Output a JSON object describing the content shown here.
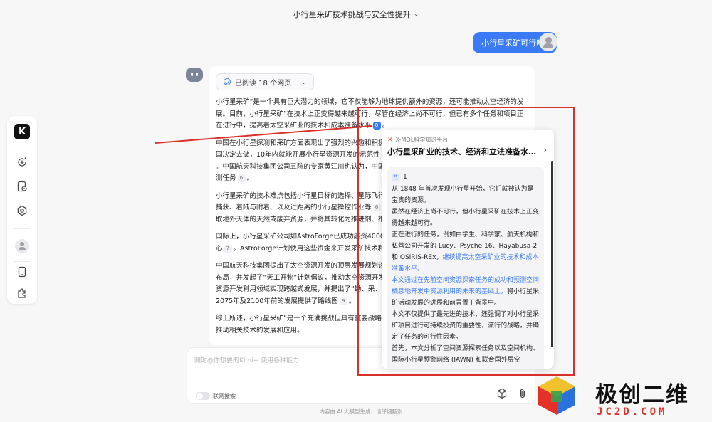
{
  "header": {
    "title": "小行星采矿技术挑战与安全性提升",
    "chevron_icon": "chevron-down-icon"
  },
  "user_message": {
    "text": "小行星采矿可行吗?"
  },
  "answer": {
    "read_chip": "已阅读 18 个网页",
    "paragraphs": [
      {
        "text_before": "小行星采矿”是一个具有巨大潜力的领域，它不仅能够为地球提供额外的资源，还可能推动太空经济的发展。目前，小行星采矿”在技术上正变得越来越可行，尽管在经济上尚不可行，但已有多个任务和项目正在进行中，提高着太空采矿业的技术和成本准备水平",
        "cite": "8",
        "text_after": "。"
      },
      {
        "text_before": "中国在小行星探测和采矿方面表现出了强烈的兴趣和积极",
        "cite": "",
        "text_after": ""
      },
      {
        "text_before": "国决定去做，10年内就能开展小行星资源开发的示范性",
        "cite": "",
        "text_after": ""
      },
      {
        "text_before": "。中国航天科技集团公司五院的专家黄江川也认为，中国",
        "cite": "",
        "text_after": ""
      },
      {
        "text_before": "测任务",
        "cite": "6",
        "text_after": "。"
      },
      {
        "text_before": "小行星采矿的技术难点包括小行星目标的选择、星际飞行",
        "cite": "",
        "text_after": ""
      },
      {
        "text_before": "捕获、着陆与附着、以及近距离的小行星操控作业等",
        "cite": "6",
        "text_after": ""
      },
      {
        "text_before": "取地外天体的天然或废弃资源，并将其转化为推进剂、推",
        "cite": "",
        "text_after": ""
      },
      {
        "text_before": "国际上，小行星采矿公司如AstroForge已成功融资4000",
        "cite": "",
        "text_after": ""
      },
      {
        "text_before": "心",
        "cite": "7",
        "text_after": "。AstroForge计划使用这些资金来开发采矿技术和"
      },
      {
        "text_before": "中国航天科技集团提出了太空资源开发的顶层发展规划设",
        "cite": "",
        "text_after": ""
      },
      {
        "text_before": "布局，并发起了“天工开物”计划倡议，推动太空资源开发",
        "cite": "",
        "text_after": ""
      },
      {
        "text_before": "资源开发利用领域实现跨越式发展，并提出了“勘、采、",
        "cite": "",
        "text_after": ""
      },
      {
        "text_before": "2075年及2100年前的发展提供了路线图",
        "cite": "9",
        "text_after": "。"
      },
      {
        "text_before": "综上所述，小行星采矿”是一个充满挑战但具有重要战略意",
        "cite": "",
        "text_after": ""
      },
      {
        "text_before": "推动相关技术的发展和应用。",
        "cite": "",
        "text_after": ""
      }
    ]
  },
  "popover": {
    "source": "X-MOL科学知识平台",
    "title": "小行星采矿业的技术、经济和立法准备水...",
    "quote_index": "1",
    "lines": [
      {
        "text": "从 1848 年首次发现小行星开始，它们就被认为是宝贵的资源。",
        "blue": false
      },
      {
        "text": "虽然在经济上尚不可行，但小行星采矿在技术上正变得越来越可行。",
        "blue": false
      },
      {
        "text": "正在进行的任务，例如由学生、科学家、航天机构和私营公司开发的 Lucy、Psyche 16、Hayabusa-2 和 OSIRIS-REx，",
        "blue": false
      },
      {
        "text": "继续提高太空采矿业的技术和成本准备水平。",
        "blue": true
      },
      {
        "text": "本文通过在先前空间资源探索任务的成功和预测空间栖息地开发中资源利用的未来的基础上，",
        "blue": true
      },
      {
        "text": "将小行星采矿活动发展的进展和前景置于背景中。",
        "blue": false
      },
      {
        "text": "本文不仅提供了最先进的技术，还强调了对小行星采矿项目进行可持续投资的重要性，流行的战略，并确定了任务的可行性因素。",
        "blue": false
      },
      {
        "text": "首先，本文分析了空间资源探索任务以及空间机构、国际小行星预警网络 (IAWN) 和联合国外层空",
        "blue": false
      }
    ]
  },
  "sidebar": {
    "logo": "K",
    "icons": [
      "new-chat-icon",
      "history-icon",
      "explore-icon",
      "user-avatar-icon",
      "phone-icon",
      "plugin-icon"
    ]
  },
  "input": {
    "placeholder": "随时@你想要的Kimi+ 使用各种能力",
    "toggle_label": "联网搜索",
    "icons": [
      "cube-icon",
      "attachment-icon"
    ]
  },
  "disclaimer": "内容由 AI 大模型生成，请仔细甄别",
  "watermark": {
    "text": "极创二维",
    "sub": "JC2D.COM",
    "colors": [
      "#e3312a",
      "#2a72d9",
      "#f2c12e",
      "#3aa04b"
    ]
  },
  "accent": "#3a7bf5",
  "frame_color": "#d9302c"
}
